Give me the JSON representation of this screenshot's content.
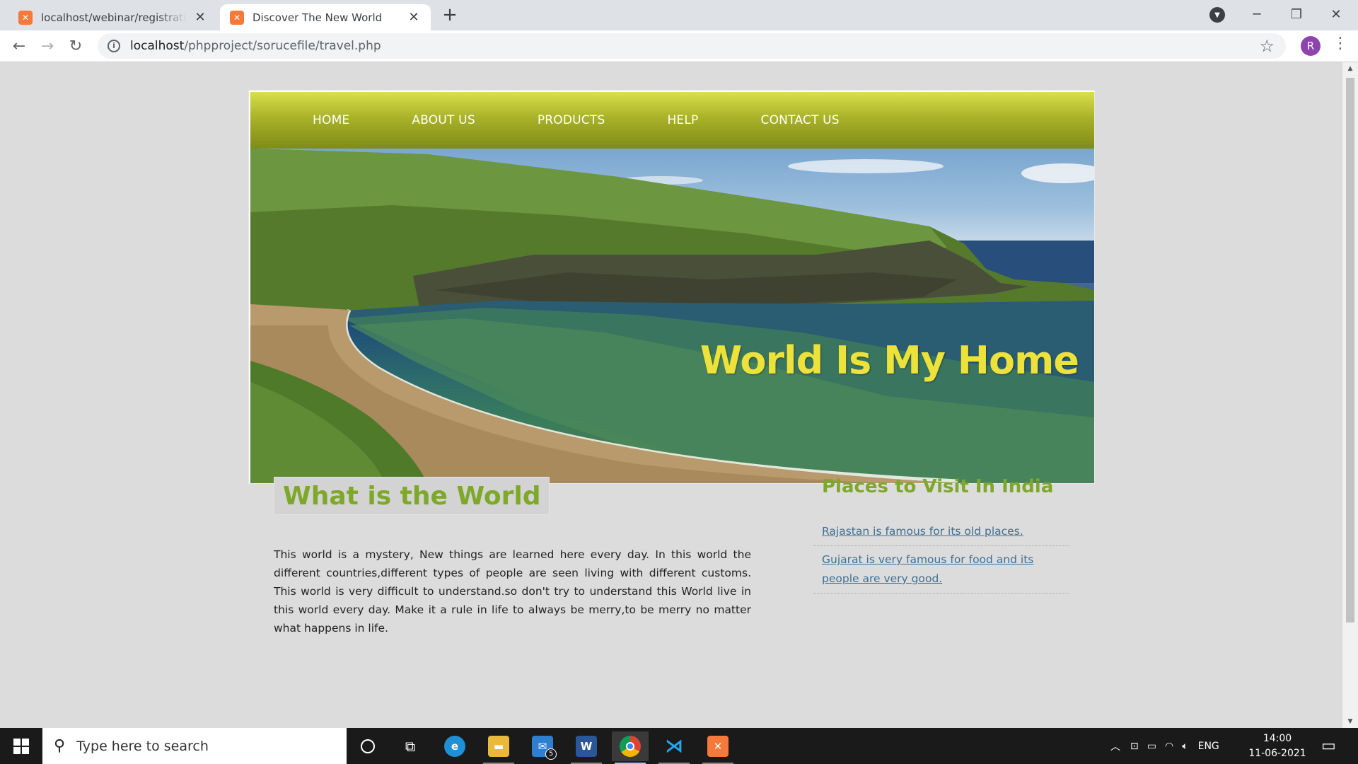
{
  "browser": {
    "tabs": [
      {
        "title": "localhost/webinar/registration fro",
        "favicon": "xampp-icon"
      },
      {
        "title": "Discover The New World",
        "favicon": "xampp-icon"
      }
    ],
    "url_host": "localhost",
    "url_path": "/phpproject/sorucefile/travel.php",
    "profile_initial": "R"
  },
  "site": {
    "nav": [
      "HOME",
      "ABOUT US",
      "PRODUCTS",
      "HELP",
      "CONTACT US"
    ],
    "hero_title": "World Is My Home",
    "main": {
      "title": "What is the World",
      "text": "This world is a mystery, New things are learned here every day. In this world the different countries,different types of people are seen living with different customs. This world is very difficult to understand.so don't try to understand this World live in this world every day. Make it a rule in life to always be merry,to be merry no matter what happens in life."
    },
    "sidebar": {
      "title": "Places to Visit In India",
      "links": [
        "Rajastan is famous for its old places.",
        "Gujarat is very famous for food and its people are very good."
      ]
    },
    "colors": {
      "nav_top": "#d9e04b",
      "nav_bottom": "#7f8c16",
      "heading_green": "#7ea82a",
      "hero_title": "#ece23a",
      "link": "#3f6f92"
    }
  },
  "taskbar": {
    "search_placeholder": "Type here to search",
    "mail_badge": "5",
    "language": "ENG",
    "time": "14:00",
    "date": "11-06-2021"
  }
}
